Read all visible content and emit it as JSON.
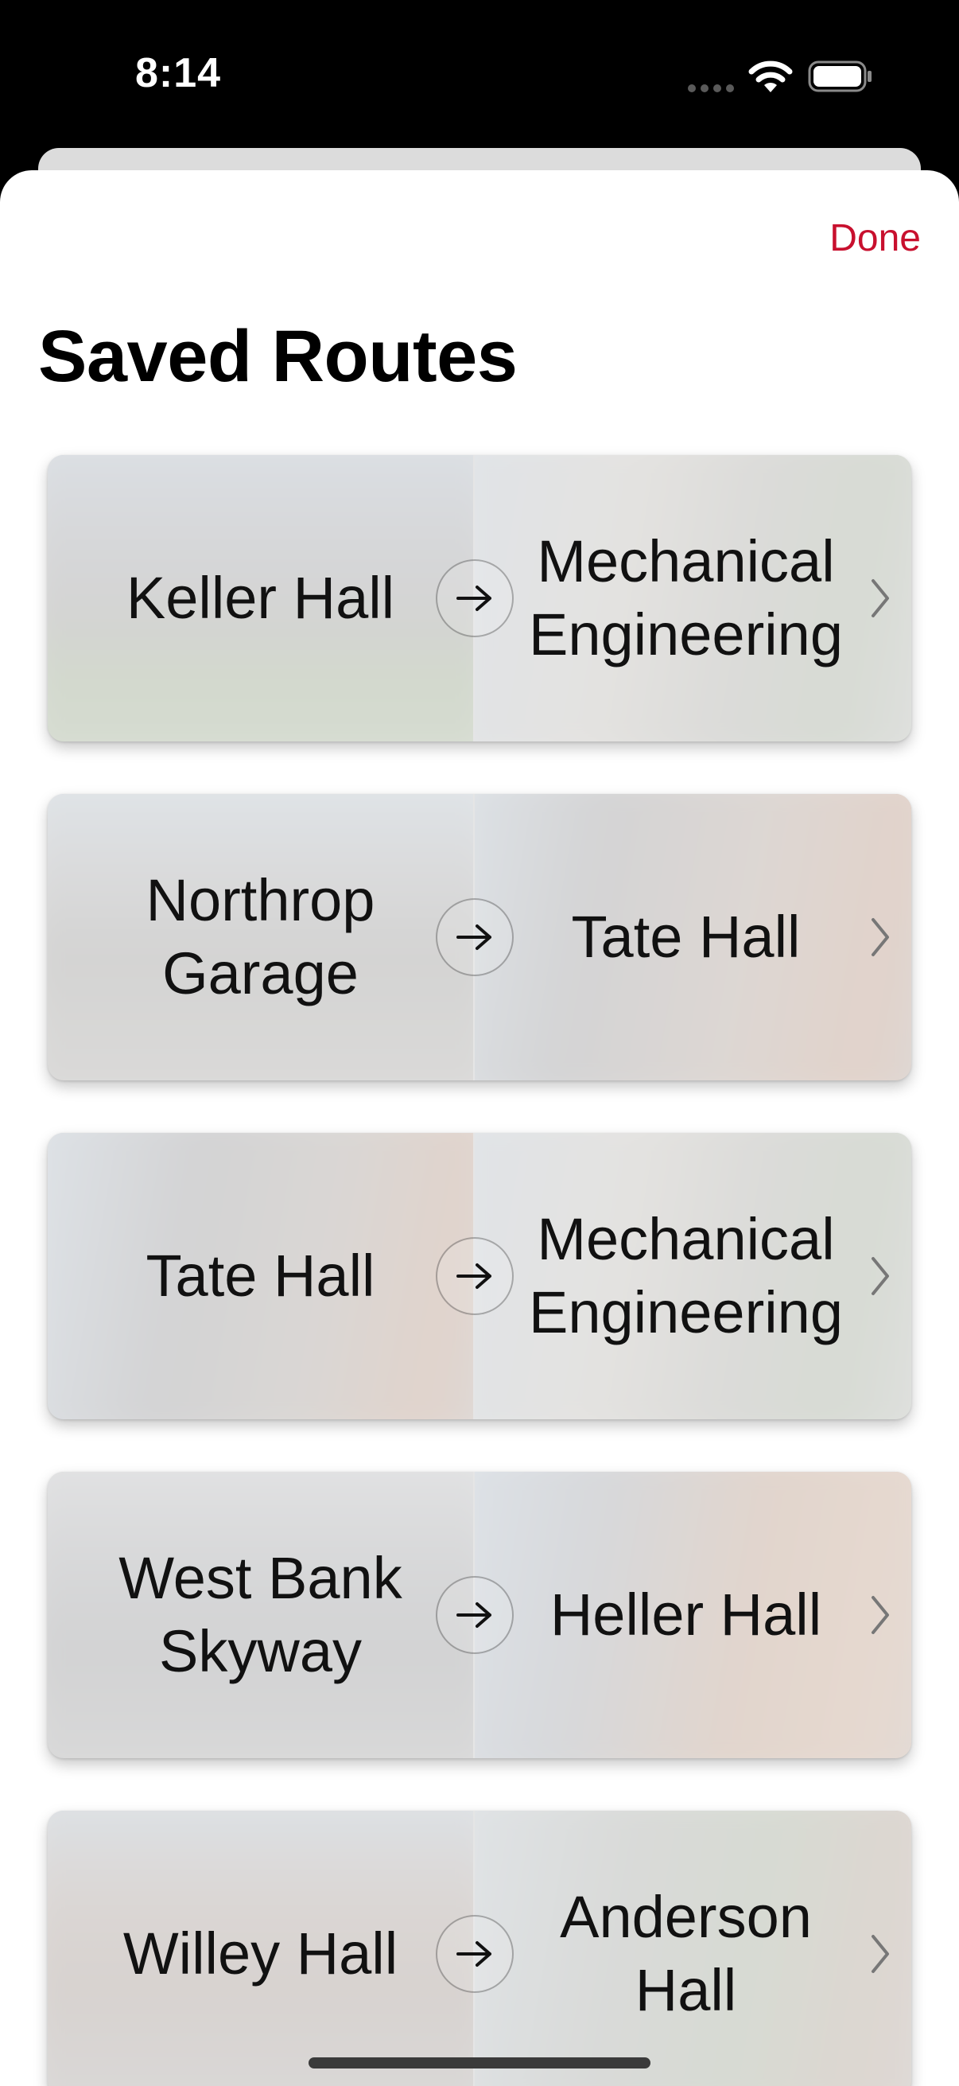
{
  "status_bar": {
    "time": "8:14",
    "icons": [
      "cellular-signal-icon",
      "wifi-icon",
      "battery-icon"
    ]
  },
  "header": {
    "done_label": "Done",
    "title": "Saved Routes"
  },
  "colors": {
    "accent": "#c8102e",
    "title": "#000000",
    "card_veil": "#eeeeee"
  },
  "routes": [
    {
      "from": "Keller Hall",
      "to": "Mechanical Engineering"
    },
    {
      "from": "Northrop Garage",
      "to": "Tate Hall"
    },
    {
      "from": "Tate Hall",
      "to": "Mechanical Engineering"
    },
    {
      "from": "West Bank Skyway",
      "to": "Heller Hall"
    },
    {
      "from": "Willey Hall",
      "to": "Anderson Hall"
    }
  ]
}
